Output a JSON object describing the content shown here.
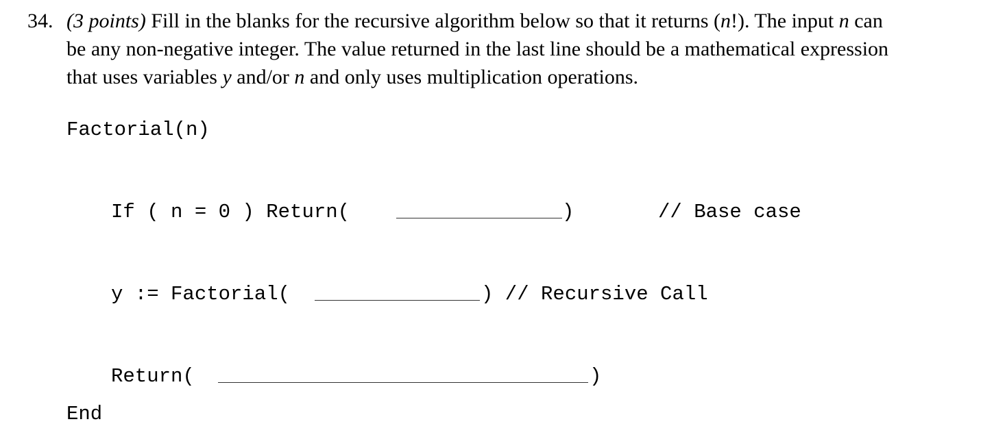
{
  "question": {
    "number": "34.",
    "points": "(3 points)",
    "line1_text": " Fill in the blanks for the recursive algorithm below so that it returns (",
    "line1_math": "n",
    "line1_after_math": "!). The input ",
    "line1_var_n": "n",
    "line1_end": " can",
    "line2_text": "be any non-negative integer. The value returned in the last line should be a mathematical expression",
    "line3_start": "that uses variables ",
    "line3_var_y": "y",
    "line3_mid": " and/or ",
    "line3_var_n": "n",
    "line3_end": " and only uses multiplication operations."
  },
  "algorithm": {
    "header": "Factorial(n)",
    "base_case": {
      "code": "If ( n = 0 ) Return( ",
      "close": ")",
      "comment": "// Base case",
      "blank_value": ""
    },
    "recursive_call": {
      "code": "y := Factorial(",
      "close": ") // Recursive Call",
      "blank_value": ""
    },
    "return_line": {
      "code": "Return( ",
      "close": ")",
      "blank_value": ""
    },
    "end": "End"
  }
}
